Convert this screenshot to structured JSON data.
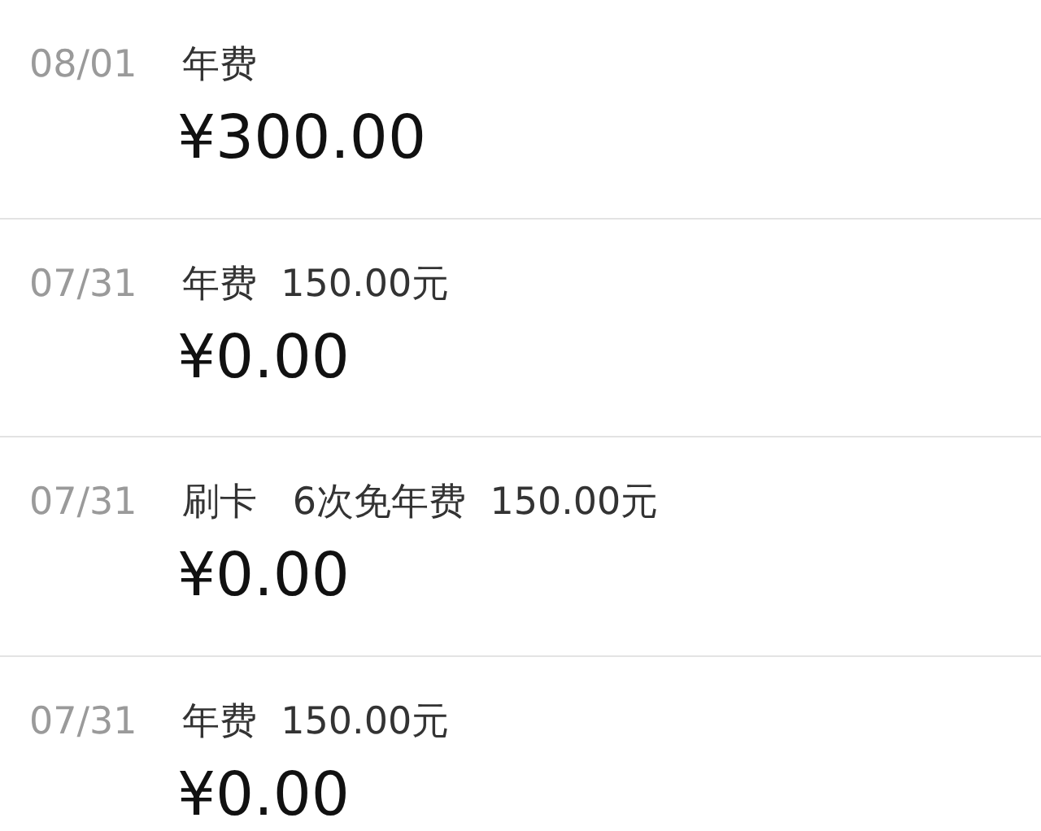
{
  "transactions": [
    {
      "date": "08/01",
      "description": "年费",
      "amount": "¥300.00"
    },
    {
      "date": "07/31",
      "description": "年费  150.00元",
      "amount": "¥0.00"
    },
    {
      "date": "07/31",
      "description": "刷卡   6次免年费  150.00元",
      "amount": "¥0.00"
    },
    {
      "date": "07/31",
      "description": "年费  150.00元",
      "amount": "¥0.00"
    }
  ]
}
